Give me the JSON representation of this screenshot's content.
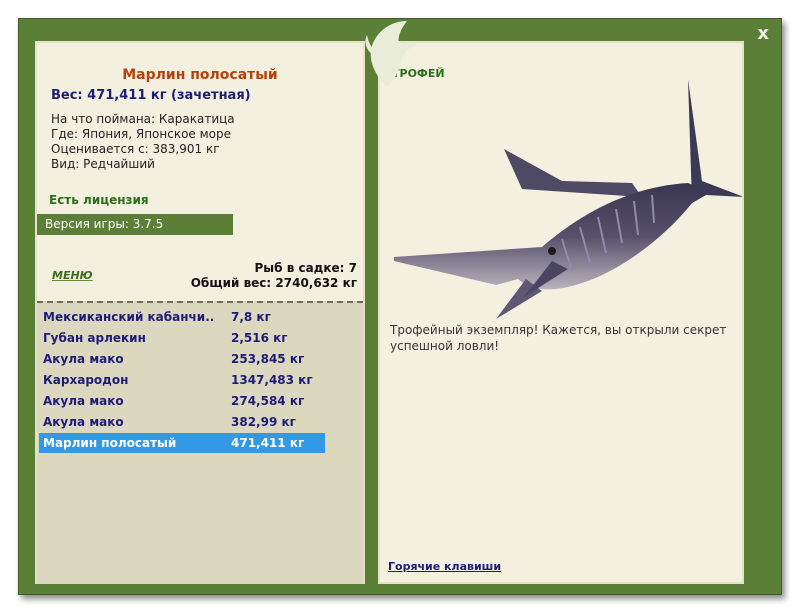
{
  "window": {
    "close_label": "x"
  },
  "fish": {
    "title": "Марлин полосатый",
    "weight_line": "Вес: 471,411 кг (зачетная)",
    "bait": "На что поймана: Каракатица",
    "location": "Где: Япония, Японское море",
    "valued_from": "Оценивается с: 383,901 кг",
    "rarity": "Вид: Редчайший"
  },
  "license": "Есть лицензия",
  "version": "Версия игры: 3.7.5",
  "menu_label": "МЕНЮ",
  "stats": {
    "fish_in_cage": "Рыб в садке: 7",
    "total_weight": "Общий вес: 2740,632 кг"
  },
  "catch_list": [
    {
      "name": "Мексиканский кабанчи...",
      "weight": "7,8 кг"
    },
    {
      "name": "Губан арлекин",
      "weight": "2,516 кг"
    },
    {
      "name": "Акула мако",
      "weight": "253,845 кг"
    },
    {
      "name": "Кархародон",
      "weight": "1347,483 кг"
    },
    {
      "name": "Акула мако",
      "weight": "274,584 кг"
    },
    {
      "name": "Акула мако",
      "weight": "382,99 кг"
    },
    {
      "name": "Марлин полосатый",
      "weight": "471,411 кг"
    }
  ],
  "selected_index": 6,
  "trophy_label": "ТРОФЕЙ",
  "trophy_text": "Трофейный экземпляр! Кажется, вы открыли секрет успешной ловли!",
  "hotkeys_label": "Горячие клавиши",
  "colors": {
    "frame": "#5b7f37",
    "panel": "#f3f0e0",
    "title": "#b8400a",
    "text_blue": "#1d1d78",
    "selection": "#3399e6"
  },
  "icons": {
    "logo": "leaping-fish-logo",
    "trophy_image": "striped-marlin-image"
  }
}
